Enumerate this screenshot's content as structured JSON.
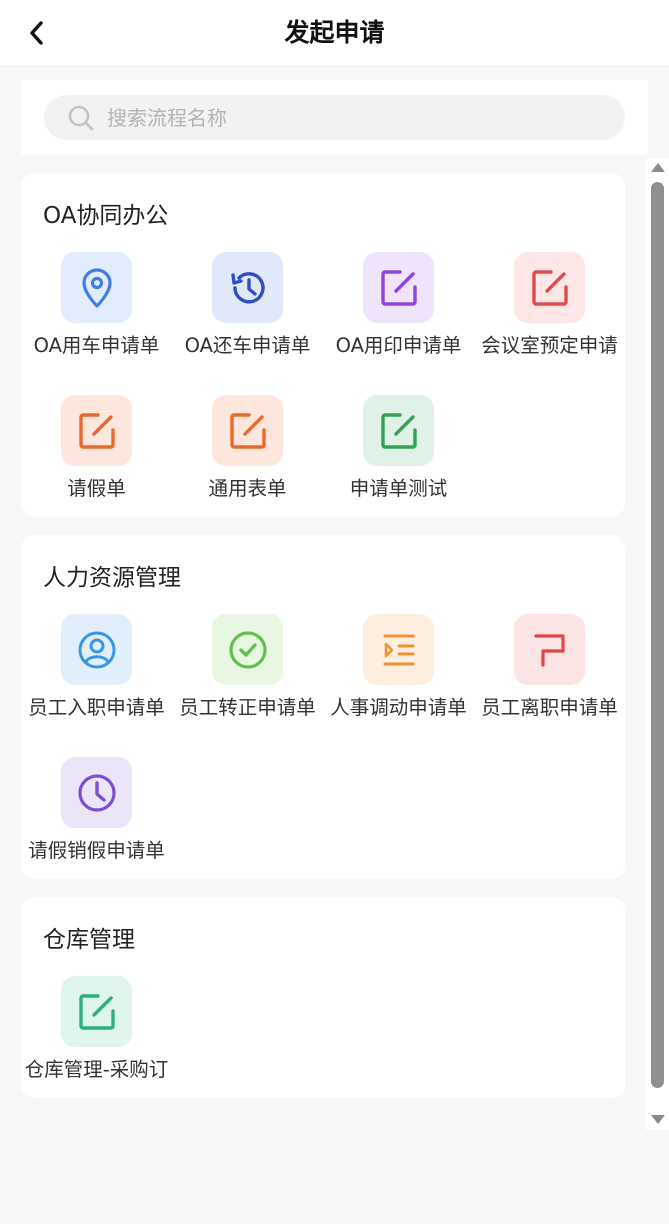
{
  "header": {
    "title": "发起申请",
    "back_icon": "chevron-left-icon"
  },
  "search": {
    "placeholder": "搜索流程名称",
    "value": "",
    "icon": "search-icon"
  },
  "sections": [
    {
      "title": "OA协同办公",
      "items": [
        {
          "label": "OA用车申请单",
          "icon": "location-pin-icon",
          "bg": "#e3ecfc",
          "color": "#3f7ee8"
        },
        {
          "label": "OA还车申请单",
          "icon": "history-icon",
          "bg": "#e1e8fb",
          "color": "#2f4fc7"
        },
        {
          "label": "OA用印申请单",
          "icon": "edit-icon",
          "bg": "#efe4fb",
          "color": "#8e44e0"
        },
        {
          "label": "会议室预定申请",
          "icon": "edit-icon",
          "bg": "#fde6e6",
          "color": "#e04a4a"
        },
        {
          "label": "请假单",
          "icon": "edit-icon",
          "bg": "#fde7dd",
          "color": "#e86a2c"
        },
        {
          "label": "通用表单",
          "icon": "edit-icon",
          "bg": "#fde7dd",
          "color": "#e86a2c"
        },
        {
          "label": "申请单测试",
          "icon": "edit-icon",
          "bg": "#e0f2e7",
          "color": "#2ea556"
        }
      ]
    },
    {
      "title": "人力资源管理",
      "items": [
        {
          "label": "员工入职申请单",
          "icon": "user-circle-icon",
          "bg": "#e1effc",
          "color": "#3796e6"
        },
        {
          "label": "员工转正申请单",
          "icon": "check-circle-icon",
          "bg": "#e8f6e2",
          "color": "#5ec24b"
        },
        {
          "label": "人事调动申请单",
          "icon": "indent-list-icon",
          "bg": "#fdeedf",
          "color": "#f09236"
        },
        {
          "label": "员工离职申请单",
          "icon": "flag-icon",
          "bg": "#fde4e4",
          "color": "#e34545"
        },
        {
          "label": "请假销假申请单",
          "icon": "clock-icon",
          "bg": "#ece4f8",
          "color": "#7c4ed3"
        }
      ]
    },
    {
      "title": "仓库管理",
      "items": [
        {
          "label": "仓库管理-采购订",
          "icon": "edit-icon",
          "bg": "#dff4ea",
          "color": "#2fb07a"
        }
      ]
    }
  ],
  "scrollbar": {
    "position": 0.03
  }
}
